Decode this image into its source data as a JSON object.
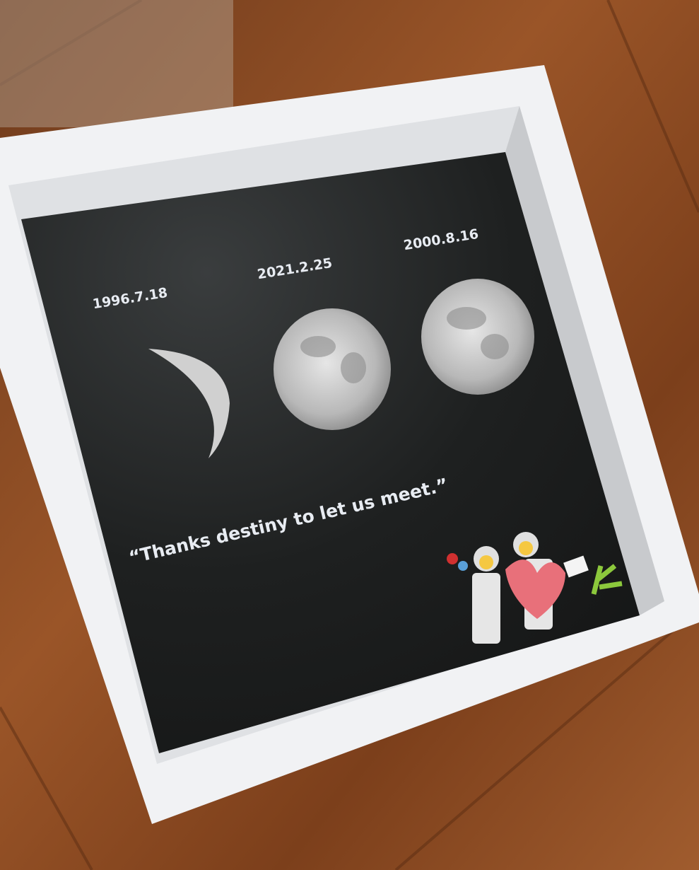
{
  "frame": {
    "dates": [
      "1996.7.18",
      "2021.2.25",
      "2000.8.16"
    ],
    "quote": "“Thanks destiny to let us meet.”"
  },
  "colors": {
    "wood": "#8a4a22",
    "frame": "#f1f2f4",
    "background": "#1c1e1e",
    "moon": "#d8d8d8",
    "heart": "#e8707a",
    "plant": "#8cc83c"
  }
}
